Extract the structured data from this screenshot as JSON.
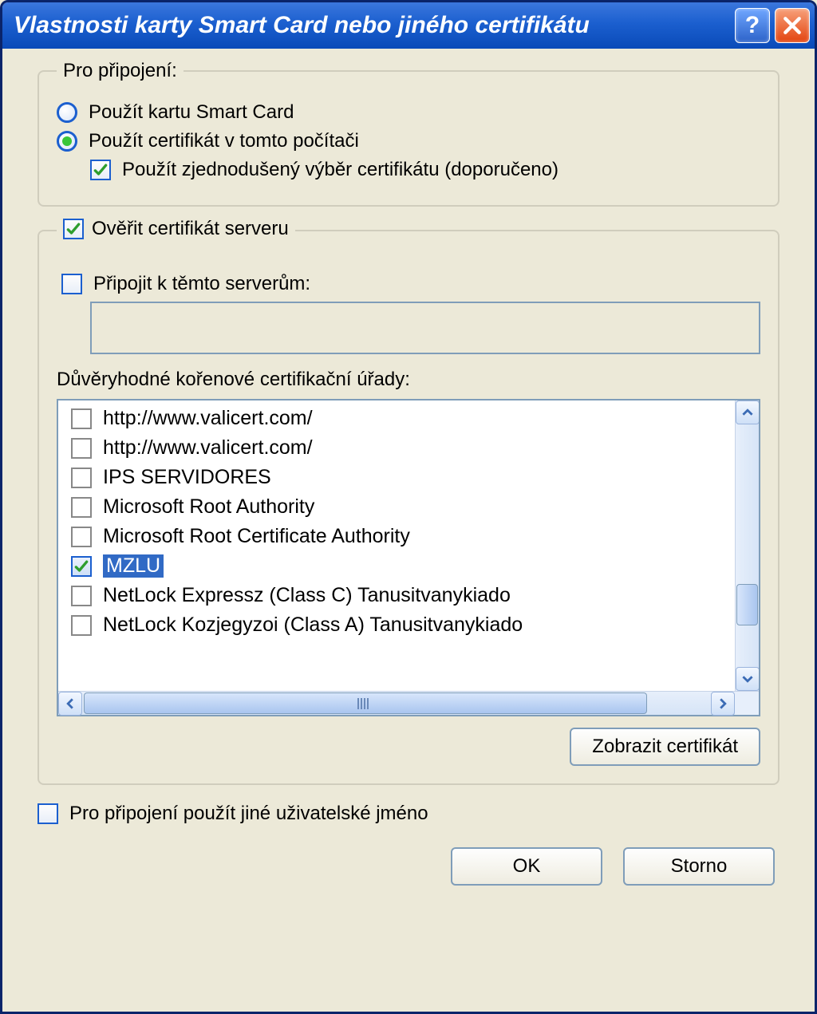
{
  "window": {
    "title": "Vlastnosti karty Smart Card nebo jiného certifikátu"
  },
  "group_connection": {
    "legend": "Pro připojení:",
    "radio_smartcard": "Použít kartu Smart Card",
    "radio_localcert": "Použít certifikát v tomto počítači",
    "check_simple": "Použít zjednodušený výběr certifikátu (doporučeno)"
  },
  "group_verify": {
    "legend": "Ověřit certifikát serveru",
    "connect_servers": "Připojit k těmto serverům:",
    "servers_value": "",
    "ca_label": "Důvěryhodné kořenové certifikační úřady:",
    "items": [
      {
        "label": "http://www.valicert.com/",
        "checked": false,
        "selected": false
      },
      {
        "label": "http://www.valicert.com/",
        "checked": false,
        "selected": false
      },
      {
        "label": "IPS SERVIDORES",
        "checked": false,
        "selected": false
      },
      {
        "label": "Microsoft Root Authority",
        "checked": false,
        "selected": false
      },
      {
        "label": "Microsoft Root Certificate Authority",
        "checked": false,
        "selected": false
      },
      {
        "label": "MZLU",
        "checked": true,
        "selected": true
      },
      {
        "label": "NetLock Expressz (Class C) Tanusitvanykiado",
        "checked": false,
        "selected": false
      },
      {
        "label": "NetLock Kozjegyzoi (Class A) Tanusitvanykiado",
        "checked": false,
        "selected": false
      }
    ],
    "view_cert": "Zobrazit certifikát"
  },
  "other_username": "Pro připojení použít jiné uživatelské jméno",
  "buttons": {
    "ok": "OK",
    "cancel": "Storno"
  }
}
